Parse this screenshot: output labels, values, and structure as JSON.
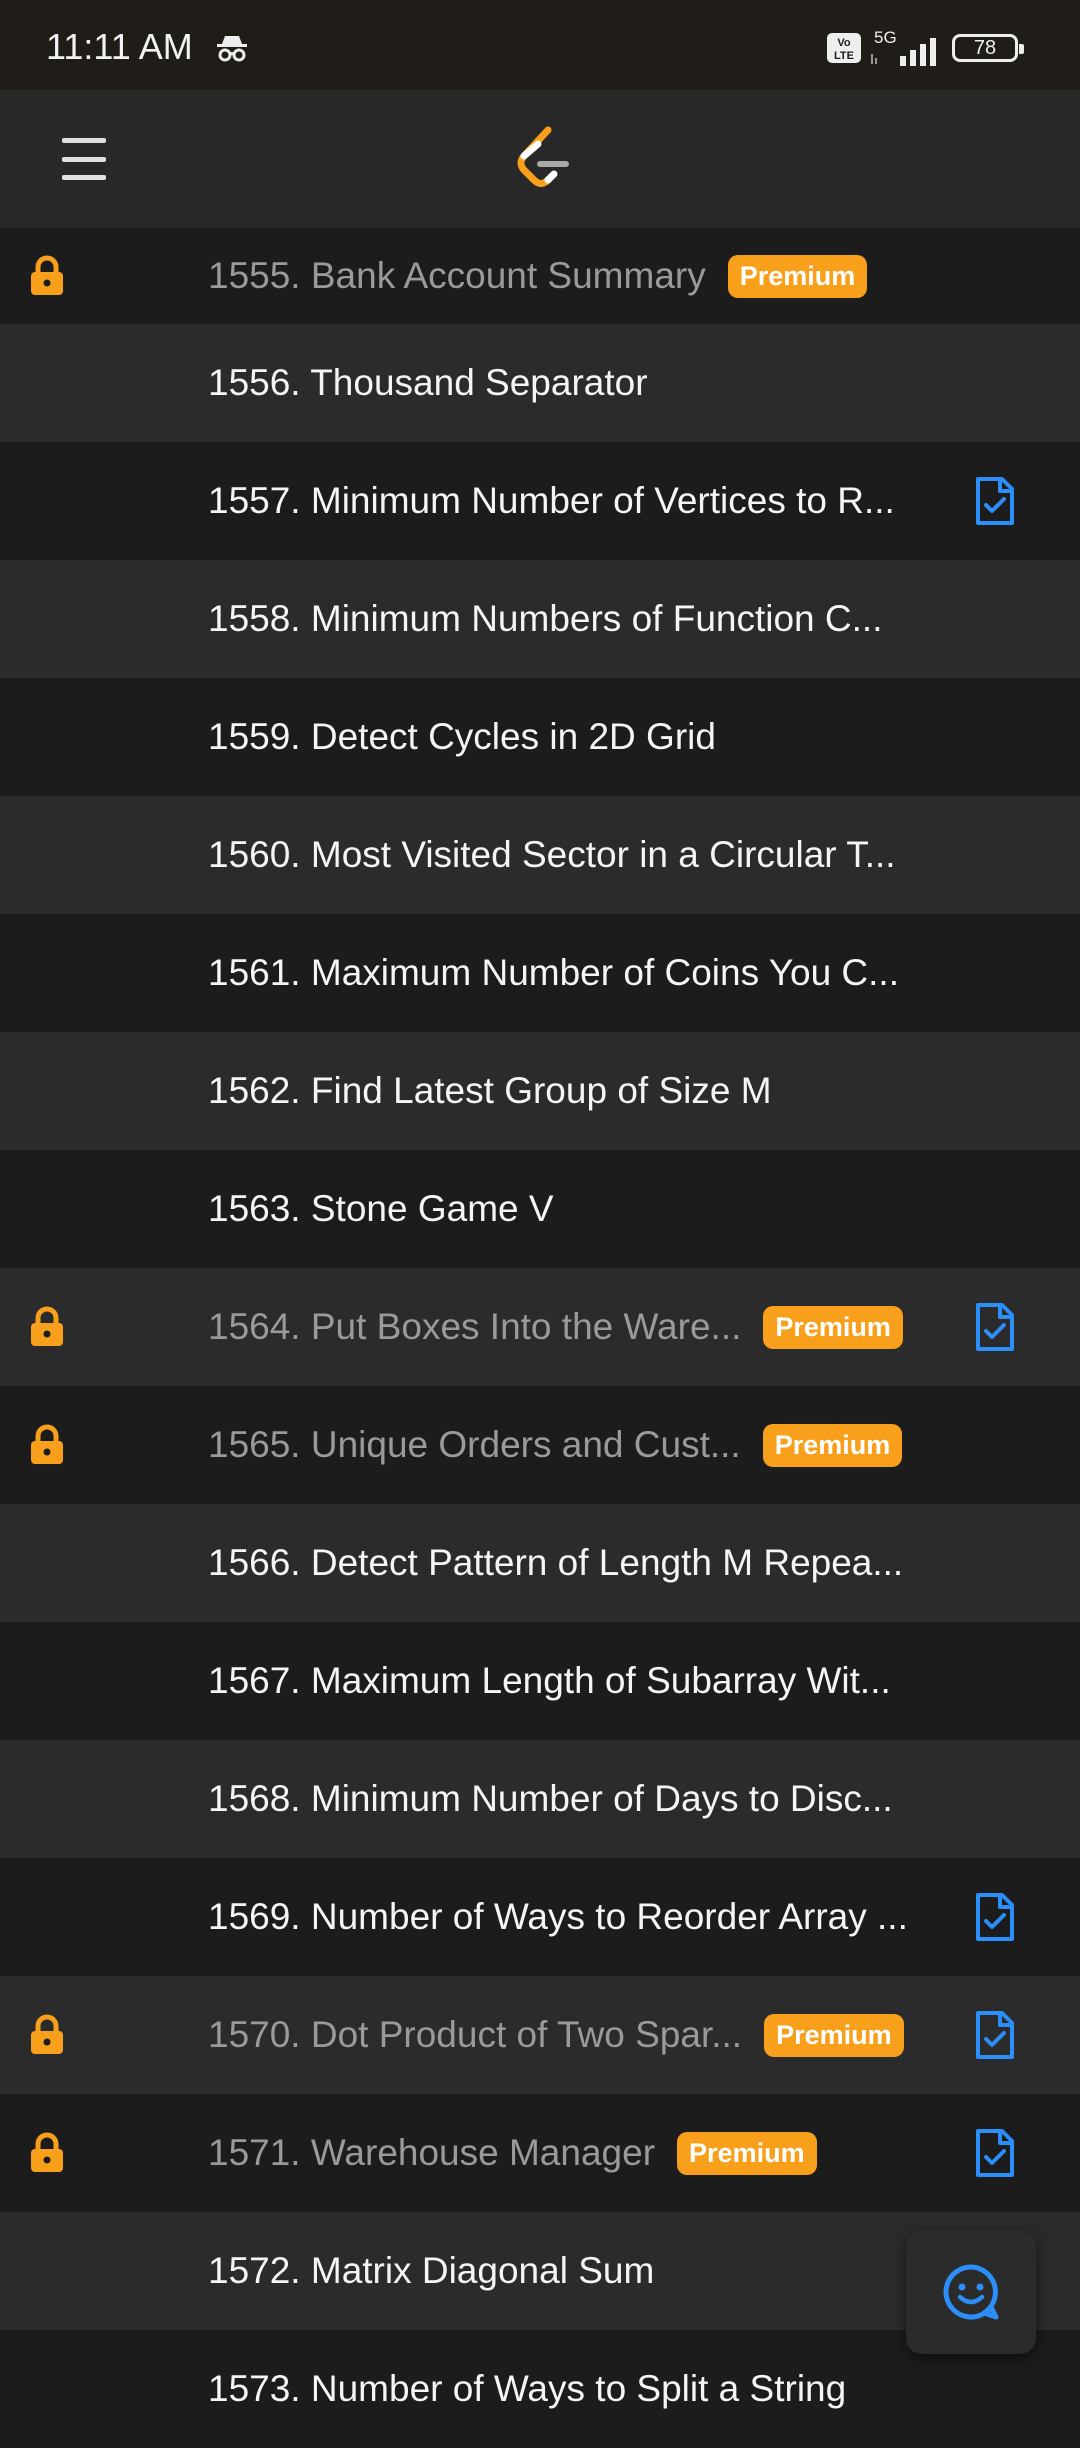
{
  "status_bar": {
    "time": "11:11 AM",
    "network": "5G",
    "battery": "78",
    "icons": [
      "incognito-icon",
      "volte-icon",
      "signal-icon",
      "battery-icon"
    ]
  },
  "app_bar": {
    "menu_icon": "hamburger-menu-icon",
    "logo": "leetcode-logo"
  },
  "colors": {
    "premium_badge": "#f8a01c",
    "lock": "#f8a01c",
    "solved_icon": "#2c8ef8",
    "row_dark": "#1c1c1c",
    "row_light": "#2b2b2b"
  },
  "problems": [
    {
      "title": "1555. Bank Account Summary",
      "premium": "Premium",
      "locked": true,
      "solved": false
    },
    {
      "title": "1556. Thousand Separator",
      "premium": "",
      "locked": false,
      "solved": false
    },
    {
      "title": "1557. Minimum Number of Vertices to R...",
      "premium": "",
      "locked": false,
      "solved": true
    },
    {
      "title": "1558. Minimum Numbers of Function C...",
      "premium": "",
      "locked": false,
      "solved": false
    },
    {
      "title": "1559. Detect Cycles in 2D Grid",
      "premium": "",
      "locked": false,
      "solved": false
    },
    {
      "title": "1560. Most Visited Sector in a Circular T...",
      "premium": "",
      "locked": false,
      "solved": false
    },
    {
      "title": "1561. Maximum Number of Coins You C...",
      "premium": "",
      "locked": false,
      "solved": false
    },
    {
      "title": "1562. Find Latest Group of Size M",
      "premium": "",
      "locked": false,
      "solved": false
    },
    {
      "title": "1563. Stone Game V",
      "premium": "",
      "locked": false,
      "solved": false
    },
    {
      "title": "1564. Put Boxes Into the Ware...",
      "premium": "Premium",
      "locked": true,
      "solved": true
    },
    {
      "title": "1565. Unique Orders and Cust...",
      "premium": "Premium",
      "locked": true,
      "solved": false
    },
    {
      "title": "1566. Detect Pattern of Length M Repea...",
      "premium": "",
      "locked": false,
      "solved": false
    },
    {
      "title": "1567. Maximum Length of Subarray Wit...",
      "premium": "",
      "locked": false,
      "solved": false
    },
    {
      "title": "1568. Minimum Number of Days to Disc...",
      "premium": "",
      "locked": false,
      "solved": false
    },
    {
      "title": "1569. Number of Ways to Reorder Array ...",
      "premium": "",
      "locked": false,
      "solved": true
    },
    {
      "title": "1570. Dot Product of Two Spar...",
      "premium": "Premium",
      "locked": true,
      "solved": true
    },
    {
      "title": "1571. Warehouse Manager",
      "premium": "Premium",
      "locked": true,
      "solved": true
    },
    {
      "title": "1572. Matrix Diagonal Sum",
      "premium": "",
      "locked": false,
      "solved": false
    },
    {
      "title": "1573. Number of Ways to Split a String",
      "premium": "",
      "locked": false,
      "solved": false
    }
  ],
  "chat_button": {
    "icon": "chat-smiley-icon"
  }
}
